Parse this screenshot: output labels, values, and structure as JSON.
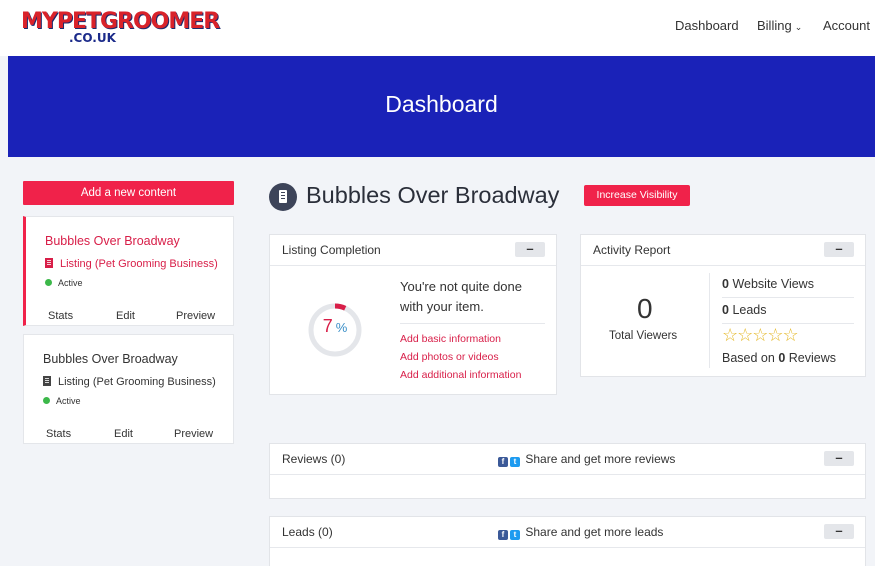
{
  "brand": {
    "logo_top": "MYPETGROOMER",
    "logo_bottom": ".CO.UK"
  },
  "nav": {
    "dashboard": "Dashboard",
    "billing": "Billing",
    "account": "Account"
  },
  "hero": {
    "title": "Dashboard"
  },
  "sidebar": {
    "add_button": "Add a new content",
    "cards": [
      {
        "title": "Bubbles Over Broadway",
        "category": "Listing (Pet Grooming Business)",
        "status": "Active",
        "stats": "Stats",
        "edit": "Edit",
        "preview": "Preview"
      },
      {
        "title": "Bubbles Over Broadway",
        "category": "Listing (Pet Grooming Business)",
        "status": "Active",
        "stats": "Stats",
        "edit": "Edit",
        "preview": "Preview"
      }
    ]
  },
  "main": {
    "title": "Bubbles Over Broadway",
    "visibility_button": "Increase Visibility",
    "listing_completion": {
      "title": "Listing Completion",
      "collapse": "–",
      "percent_value": "7",
      "percent_symbol": "%",
      "progress_fraction": 0.07,
      "message": "You're not quite done with your item.",
      "links": [
        "Add basic information",
        "Add photos or videos",
        "Add additional information"
      ]
    },
    "activity_report": {
      "title": "Activity Report",
      "collapse": "–",
      "total_viewers_value": "0",
      "total_viewers_label": "Total Viewers",
      "website_views_count": "0",
      "website_views_label": "Website Views",
      "leads_count": "0",
      "leads_label": "Leads",
      "stars": "☆☆☆☆☆",
      "rating_stars": 0,
      "reviews_prefix": "Based on",
      "reviews_count": "0",
      "reviews_suffix": "Reviews"
    },
    "reviews": {
      "title": "Reviews (0)",
      "share": "Share and get more reviews",
      "collapse": "–"
    },
    "leads": {
      "title": "Leads (0)",
      "share": "Share and get more leads",
      "collapse": "–"
    }
  },
  "colors": {
    "primary_blue": "#1a22b8",
    "accent_red": "#f0224a",
    "status_green": "#3cb84a",
    "star_gold": "#e5b92a"
  }
}
